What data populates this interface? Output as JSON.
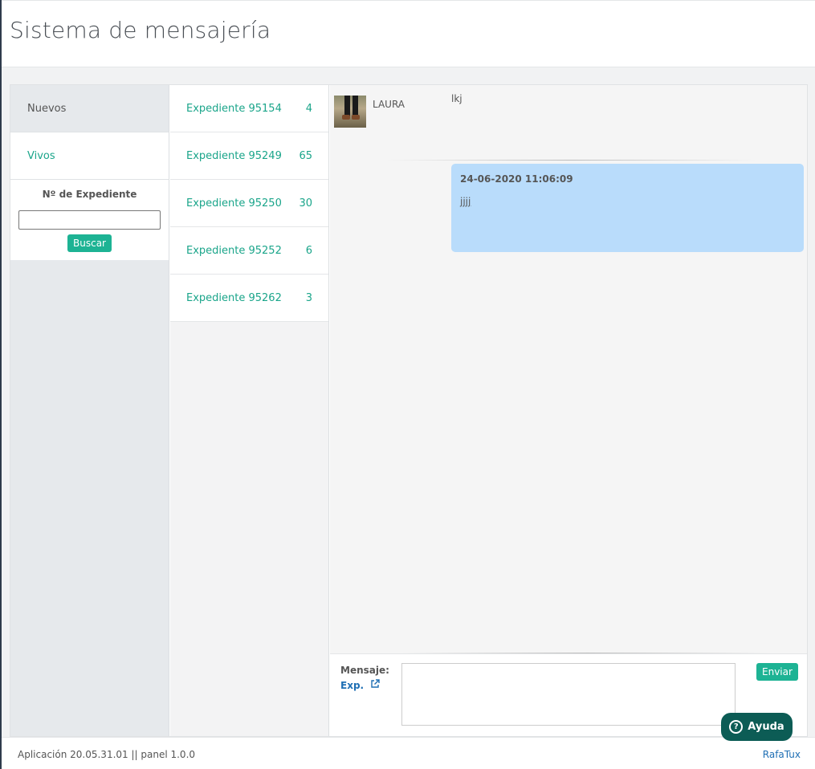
{
  "header": {
    "title": "Sistema de mensajería"
  },
  "sidebar": {
    "items": [
      {
        "label": "Nuevos"
      },
      {
        "label": "Vivos"
      }
    ],
    "search": {
      "label": "Nº de Expediente",
      "value": "",
      "button": "Buscar"
    }
  },
  "expedientes": [
    {
      "label": "Expediente 95154",
      "count": "4"
    },
    {
      "label": "Expediente 95249",
      "count": "65"
    },
    {
      "label": "Expediente 95250",
      "count": "30"
    },
    {
      "label": "Expediente 95252",
      "count": "6"
    },
    {
      "label": "Expediente 95262",
      "count": "3"
    }
  ],
  "chat": {
    "incoming": {
      "sender": "LAURA",
      "text": "lkj"
    },
    "outgoing": {
      "timestamp": "24-06-2020 11:06:09",
      "text": "jjjj"
    }
  },
  "composer": {
    "label": "Mensaje:",
    "link": "Exp.",
    "value": "",
    "send": "Enviar"
  },
  "help": {
    "label": "Ayuda"
  },
  "footer": {
    "version": "Aplicación 20.05.31.01 || panel 1.0.0",
    "brand": "RafaTux"
  }
}
